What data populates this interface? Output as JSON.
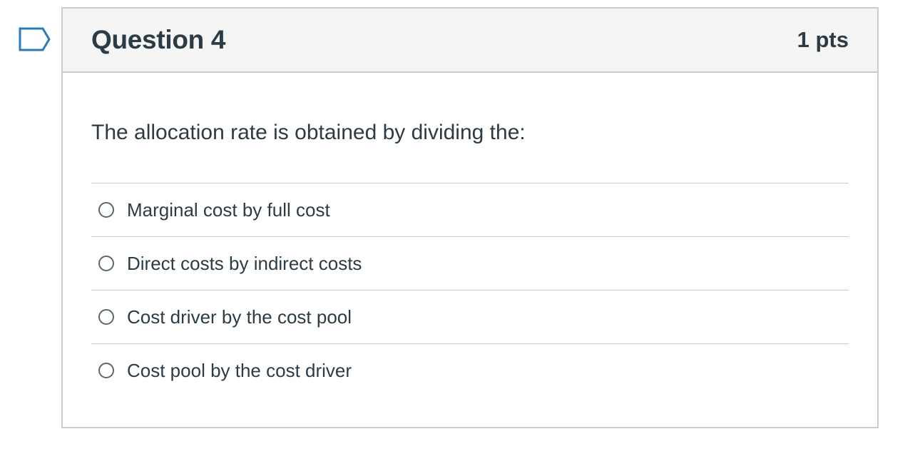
{
  "question": {
    "title": "Question 4",
    "points": "1 pts",
    "text": "The allocation rate is obtained by dividing the:",
    "flag_icon": "bookmark-flag-icon",
    "answers": [
      {
        "label": "Marginal cost by full cost",
        "selected": false
      },
      {
        "label": "Direct costs by indirect costs",
        "selected": false
      },
      {
        "label": "Cost driver by the cost pool",
        "selected": false
      },
      {
        "label": "Cost pool by the cost driver",
        "selected": false
      }
    ]
  },
  "colors": {
    "text": "#2d3b45",
    "border": "#c7cdd1",
    "header_bg": "#f5f5f5",
    "flag": "#2c7bb6"
  }
}
